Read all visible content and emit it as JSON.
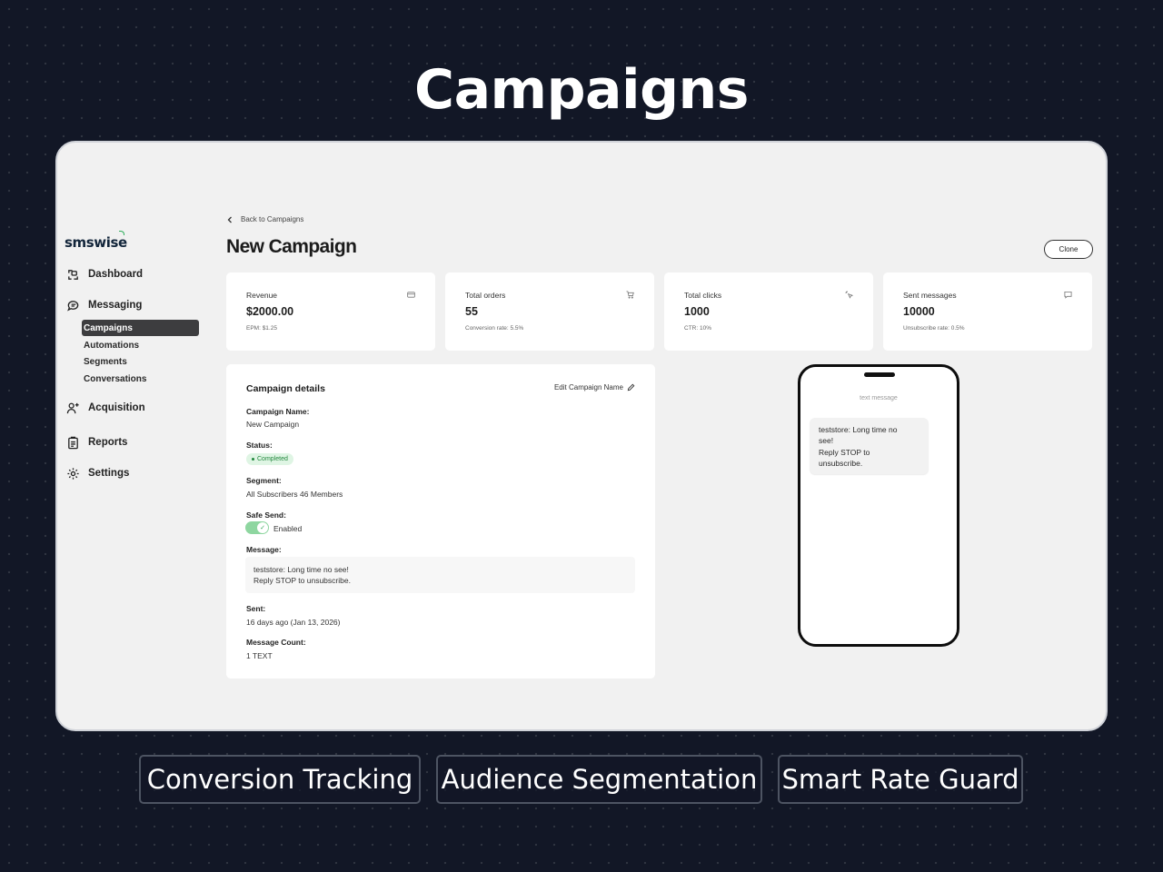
{
  "hero": {
    "title": "Campaigns"
  },
  "sidebar": {
    "logo": "smswise",
    "items": [
      {
        "label": "Dashboard",
        "icon": "dashboard-icon"
      },
      {
        "label": "Messaging",
        "icon": "chat-icon"
      },
      {
        "label": "Acquisition",
        "icon": "add-user-icon"
      },
      {
        "label": "Reports",
        "icon": "clipboard-icon"
      },
      {
        "label": "Settings",
        "icon": "gear-icon"
      }
    ],
    "messaging_sub": [
      {
        "label": "Campaigns",
        "active": true
      },
      {
        "label": "Automations"
      },
      {
        "label": "Segments"
      },
      {
        "label": "Conversations"
      }
    ]
  },
  "header": {
    "back_label": "Back to Campaigns",
    "title": "New Campaign",
    "clone_label": "Clone"
  },
  "stats": [
    {
      "label": "Revenue",
      "value": "$2000.00",
      "sub": "EPM: $1.25",
      "icon": "card-icon"
    },
    {
      "label": "Total orders",
      "value": "55",
      "sub": "Conversion rate: 5.5%",
      "icon": "cart-icon"
    },
    {
      "label": "Total clicks",
      "value": "1000",
      "sub": "CTR: 10%",
      "icon": "cursor-click-icon"
    },
    {
      "label": "Sent messages",
      "value": "10000",
      "sub": "Unsubscribe rate: 0.5%",
      "icon": "message-icon"
    }
  ],
  "details": {
    "title": "Campaign details",
    "edit_label": "Edit Campaign Name",
    "name_label": "Campaign Name:",
    "name_value": "New Campaign",
    "status_label": "Status:",
    "status_value": "Completed",
    "segment_label": "Segment:",
    "segment_value": "All Subscribers  46 Members",
    "safe_send_label": "Safe Send:",
    "safe_send_value": "Enabled",
    "message_label": "Message:",
    "message_lines": [
      "teststore: Long time no see!",
      "Reply STOP to unsubscribe."
    ],
    "sent_label": "Sent:",
    "sent_value": "16 days ago (Jan 13, 2026)",
    "count_label": "Message Count:",
    "count_value": "1 TEXT"
  },
  "phone": {
    "label": "text message",
    "bubble_lines": [
      "teststore: Long time no",
      "see!",
      "Reply STOP to",
      "unsubscribe."
    ]
  },
  "features": [
    "Conversion Tracking",
    "Audience Segmentation",
    "Smart Rate Guard"
  ],
  "colors": {
    "background": "#121726",
    "status_green": "#23883e",
    "toggle_green": "#8ed6a0",
    "active_nav": "#3d3d3f"
  }
}
